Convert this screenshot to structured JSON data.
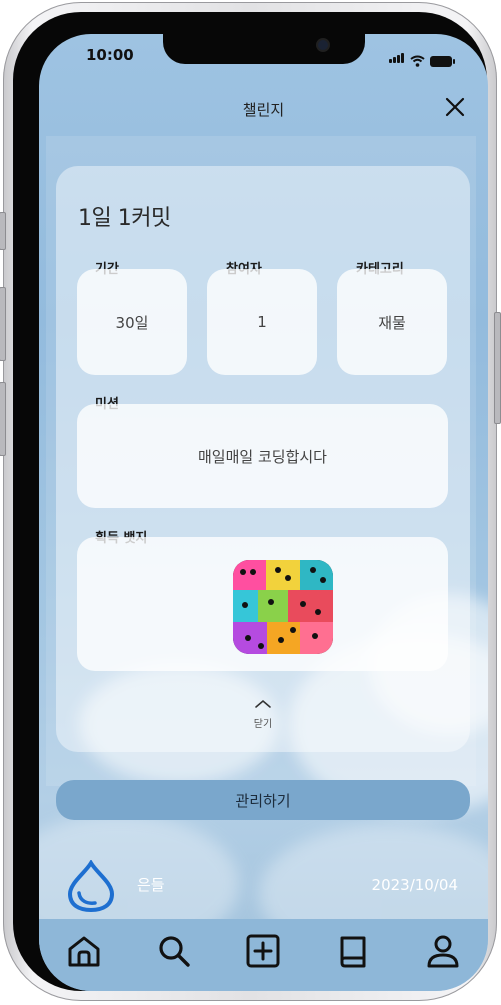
{
  "status_bar": {
    "time": "10:00"
  },
  "header": {
    "title": "챌린지"
  },
  "challenge": {
    "title": "1일 1커밋",
    "period": {
      "label": "기간",
      "value": "30일"
    },
    "participants": {
      "label": "참여자",
      "value": "1"
    },
    "category": {
      "label": "카테고리",
      "value": "재물"
    },
    "mission": {
      "label": "미션",
      "value": "매일매일 코딩합시다"
    },
    "badge": {
      "label": "획득 뱃지",
      "icon": "colorful-grid-badge-icon"
    },
    "collapse_label": "닫기"
  },
  "manage_label": "관리하기",
  "footer": {
    "user_name": "은들",
    "date": "2023/10/04"
  },
  "nav": [
    "home-icon",
    "search-icon",
    "add-icon",
    "book-icon",
    "profile-icon"
  ],
  "colors": {
    "accent": "#7aa7cc",
    "nav_bg": "#8eb7d8",
    "logo": "#1e6fd0"
  }
}
